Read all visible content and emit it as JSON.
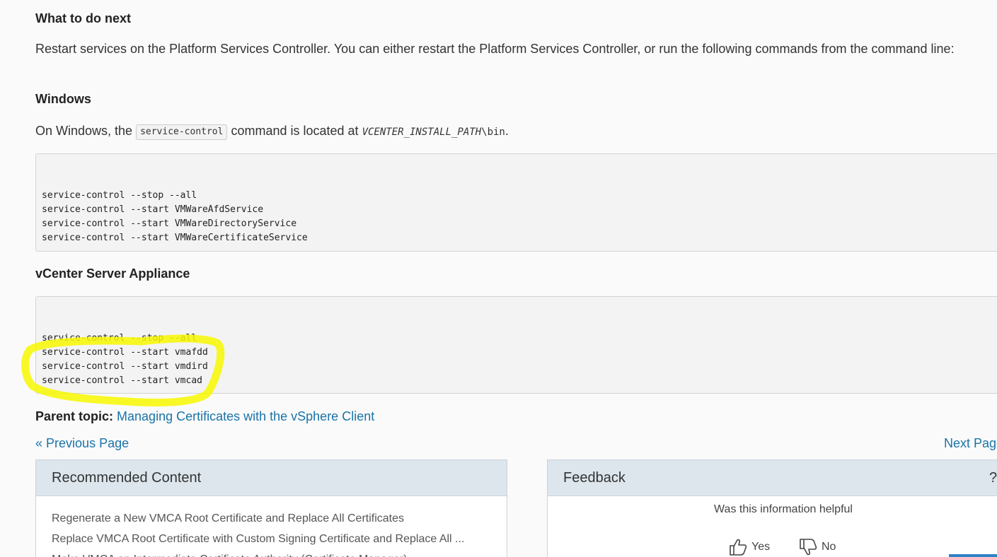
{
  "next_section": {
    "heading": "What to do next",
    "paragraph": "Restart services on the Platform Services Controller. You can either restart the Platform Services Controller, or run the following commands from the command line:"
  },
  "windows": {
    "heading": "Windows",
    "text_before": "On Windows, the ",
    "inline_code": "service-control",
    "text_middle": " command is located at ",
    "path_var": "VCENTER_INSTALL_PATH",
    "path_suffix": "\\bin",
    "text_end": ".",
    "code_lines": [
      "service-control --stop --all",
      "service-control --start VMWareAfdService",
      "service-control --start VMWareDirectoryService",
      "service-control --start VMWareCertificateService"
    ]
  },
  "vcsa": {
    "heading": "vCenter Server Appliance",
    "code_lines": [
      "service-control --stop --all",
      "service-control --start vmafdd",
      "service-control --start vmdird",
      "service-control --start vmcad"
    ],
    "highlight_color": "#f7f700"
  },
  "parent_topic": {
    "label": "Parent topic:",
    "link_text": "Managing Certificates with the vSphere Client"
  },
  "pagination": {
    "prev_icon": "«",
    "prev_label": "Previous Page",
    "next_label": "Next Page"
  },
  "recommended": {
    "title": "Recommended Content",
    "items": [
      "Regenerate a New VMCA Root Certificate and Replace All Certificates",
      "Replace VMCA Root Certificate with Custom Signing Certificate and Replace All ...",
      "Make VMCA an Intermediate Certificate Authority (Certificate Manager)"
    ]
  },
  "feedback": {
    "title": "Feedback",
    "help_icon": "?",
    "question": "Was this information helpful",
    "yes_label": "Yes",
    "no_label": "No"
  },
  "colors": {
    "link": "#1a73a8",
    "panel_header_bg": "#dde6ed",
    "code_bg": "#f3f3f3",
    "accent_bar": "#2f83c5"
  }
}
